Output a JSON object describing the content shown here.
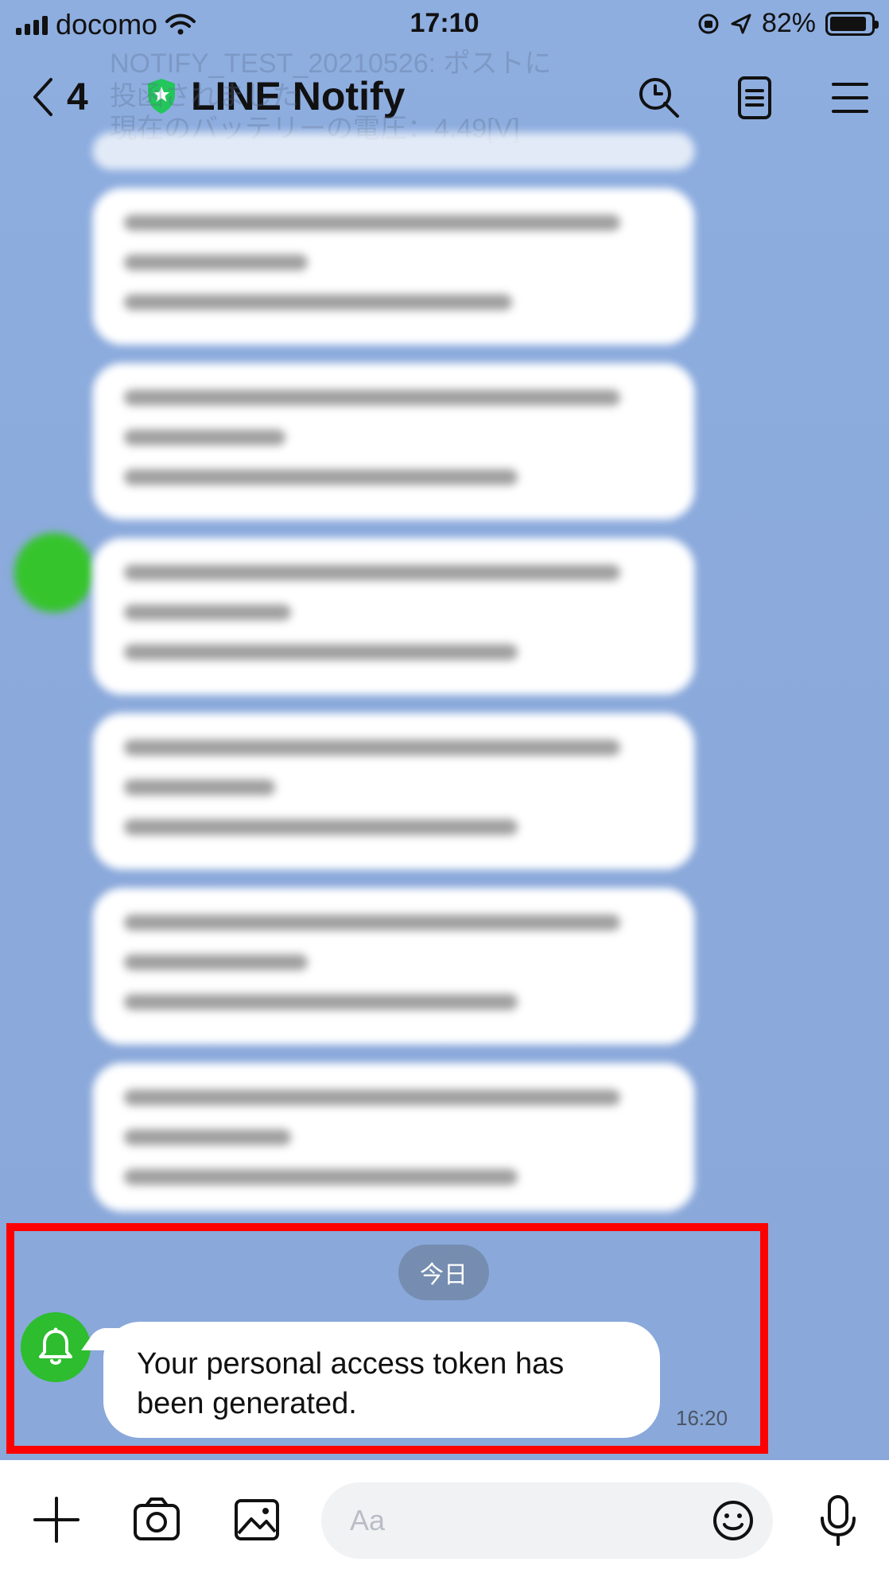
{
  "status_bar": {
    "carrier": "docomo",
    "time": "17:10",
    "battery": "82%"
  },
  "header": {
    "back_count": "4",
    "title": "LINE Notify"
  },
  "ghost": {
    "line1": "NOTIFY_TEST_20210526: ポストに",
    "line2": "投函されました",
    "line3": "現在のバッテリーの電圧：4.49[V]"
  },
  "chat": {
    "date_label": "今日",
    "message_text": "Your personal access token has been generated.",
    "message_time": "16:20"
  },
  "input": {
    "placeholder": "Aa"
  },
  "icons": {
    "back": "back-chevron-icon",
    "shield": "shield-icon",
    "search": "search-icon",
    "notes": "notes-icon",
    "menu": "menu-icon",
    "bell": "bell-icon",
    "plus": "plus-icon",
    "camera": "camera-icon",
    "image": "image-icon",
    "emoji": "emoji-icon",
    "mic": "microphone-icon"
  },
  "colors": {
    "background": "#8eaee0",
    "accent_green": "#2dbd2f",
    "highlight_red": "#ff0000"
  }
}
